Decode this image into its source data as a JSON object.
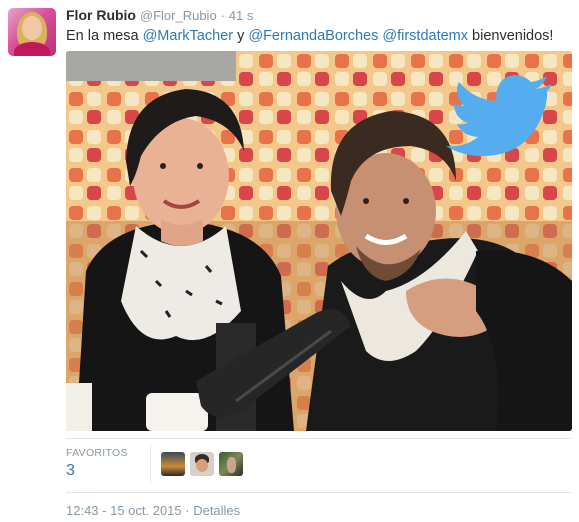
{
  "tweet": {
    "author": {
      "name": "Flor Rubio",
      "handle": "@Flor_Rubio",
      "separator": "·",
      "time_ago": "41 s"
    },
    "text": {
      "part1": "En la mesa ",
      "mention1": "@MarkTacher",
      "part2": " y ",
      "mention2": "@FernandaBorches",
      "part3": " ",
      "mention3": "@firstdatemx",
      "part4": " bienvenidos!"
    },
    "media": {
      "watermark_icon": "twitter-bird-icon"
    },
    "stats": {
      "favorites_label": "FAVORITOS",
      "favorites_count": "3"
    },
    "timestamp": "12:43 - 15 oct. 2015 · Detalles"
  },
  "colors": {
    "link": "#2b7bb9",
    "muted": "#8899a6",
    "text": "#292f33",
    "twitter_blue": "#55acee"
  }
}
